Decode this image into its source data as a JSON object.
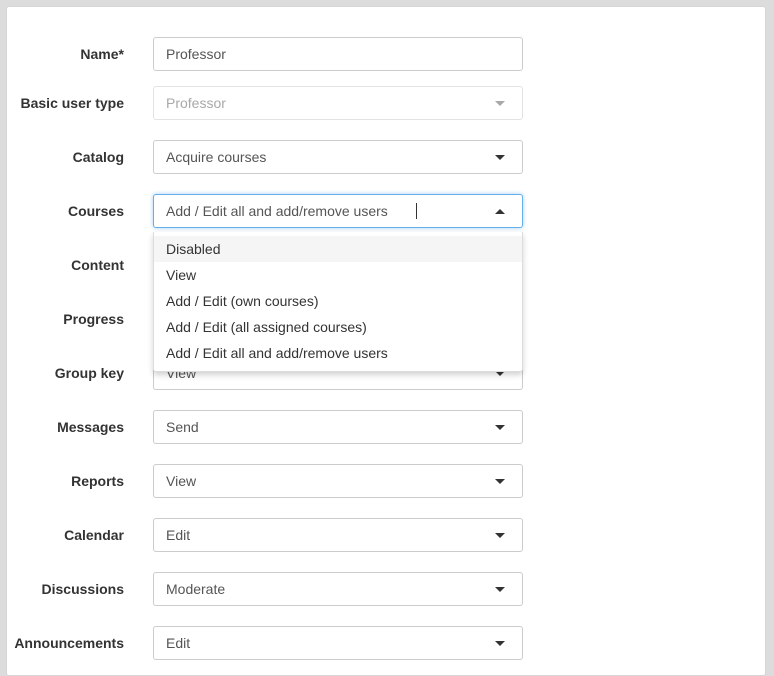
{
  "form": {
    "fields": [
      {
        "key": "name",
        "label": "Name*",
        "value": "Professor",
        "type": "text"
      },
      {
        "key": "basic_user_type",
        "label": "Basic user type",
        "value": "Professor",
        "type": "select",
        "disabled": true
      },
      {
        "key": "catalog",
        "label": "Catalog",
        "value": "Acquire courses",
        "type": "select"
      },
      {
        "key": "courses",
        "label": "Courses",
        "value": "Add / Edit all and add/remove users",
        "type": "select",
        "open": true
      },
      {
        "key": "content",
        "label": "Content",
        "value": "",
        "type": "select"
      },
      {
        "key": "progress",
        "label": "Progress",
        "value": "",
        "type": "select"
      },
      {
        "key": "group_key",
        "label": "Group key",
        "value": "View",
        "type": "select"
      },
      {
        "key": "messages",
        "label": "Messages",
        "value": "Send",
        "type": "select"
      },
      {
        "key": "reports",
        "label": "Reports",
        "value": "View",
        "type": "select"
      },
      {
        "key": "calendar",
        "label": "Calendar",
        "value": "Edit",
        "type": "select"
      },
      {
        "key": "discussions",
        "label": "Discussions",
        "value": "Moderate",
        "type": "select"
      },
      {
        "key": "announcements",
        "label": "Announcements",
        "value": "Edit",
        "type": "select"
      }
    ]
  },
  "courses_dropdown": {
    "highlighted_index": 0,
    "options": [
      "Disabled",
      "View",
      "Add / Edit (own courses)",
      "Add / Edit (all assigned courses)",
      "Add / Edit all and add/remove users"
    ]
  },
  "icons": {
    "select_arrow": "caret-down-icon",
    "open_arrow": "caret-up-icon"
  },
  "colors": {
    "focus_border": "#66afe9",
    "label_text": "#333333",
    "field_text": "#555555",
    "disabled_text": "#a8a8a8"
  }
}
